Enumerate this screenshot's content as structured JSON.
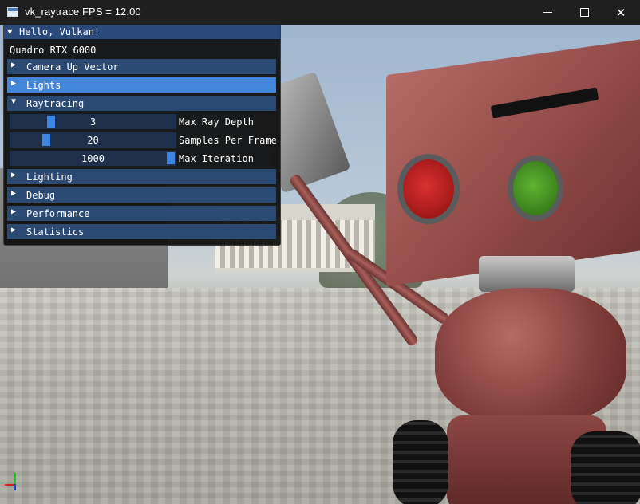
{
  "window": {
    "title": "vk_raytrace  FPS = 12.00"
  },
  "imgui": {
    "title": "Hello, Vulkan!",
    "gpu_name": "Quadro RTX 6000",
    "headers": [
      {
        "label": "Camera Up Vector",
        "expanded": false
      },
      {
        "label": "Lights",
        "expanded": false
      },
      {
        "label": "Raytracing",
        "expanded": true
      },
      {
        "label": "Lighting",
        "expanded": false
      },
      {
        "label": "Debug",
        "expanded": false
      },
      {
        "label": "Performance",
        "expanded": false
      },
      {
        "label": "Statistics",
        "expanded": false
      }
    ],
    "sliders": [
      {
        "label": "Max Ray Depth",
        "value": "3",
        "fraction": 0.23
      },
      {
        "label": "Samples Per Frame",
        "value": "20",
        "fraction": 0.2
      },
      {
        "label": "Max Iteration",
        "value": "1000",
        "fraction": 1.0
      }
    ]
  },
  "icons": {
    "collapsed": "▶",
    "expanded": "▼"
  },
  "colors": {
    "header": "#2b4a73",
    "header_hover": "#4186d8",
    "title_active": "#294a7a",
    "slider_grab": "#3d85e0"
  }
}
